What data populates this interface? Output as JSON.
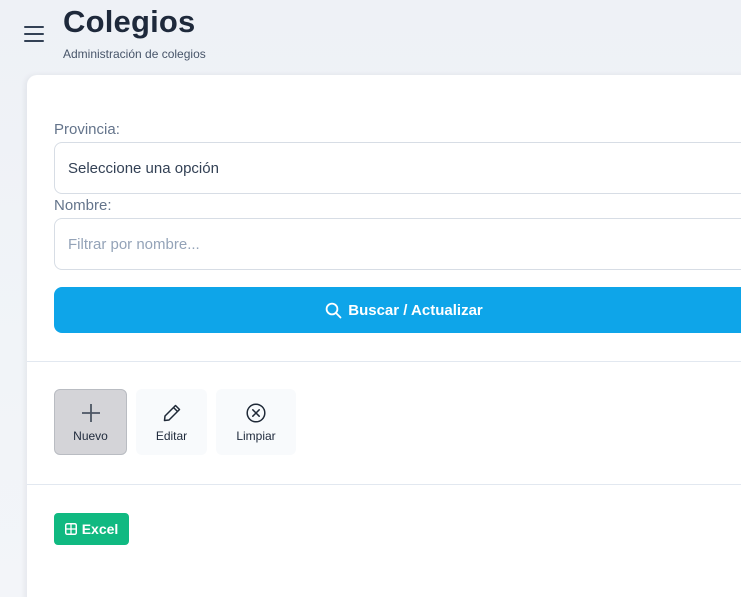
{
  "header": {
    "title": "Colegios",
    "subtitle": "Administración de colegios",
    "menu_icon": "hamburger-menu-icon"
  },
  "filters": {
    "provincia": {
      "label": "Provincia:",
      "selected": "Seleccione una opción"
    },
    "nombre": {
      "label": "Nombre:",
      "value": "",
      "placeholder": "Filtrar por nombre..."
    },
    "search_button": {
      "label": "Buscar / Actualizar",
      "icon": "search-icon",
      "color": "#0ea5e9"
    }
  },
  "toolbar": {
    "nuevo": {
      "label": "Nuevo",
      "icon": "plus-icon",
      "active": true
    },
    "editar": {
      "label": "Editar",
      "icon": "pencil-icon"
    },
    "limpiar": {
      "label": "Limpiar",
      "icon": "circle-x-icon"
    }
  },
  "export": {
    "excel": {
      "label": "Excel",
      "icon": "spreadsheet-icon",
      "color": "#10b981"
    }
  }
}
